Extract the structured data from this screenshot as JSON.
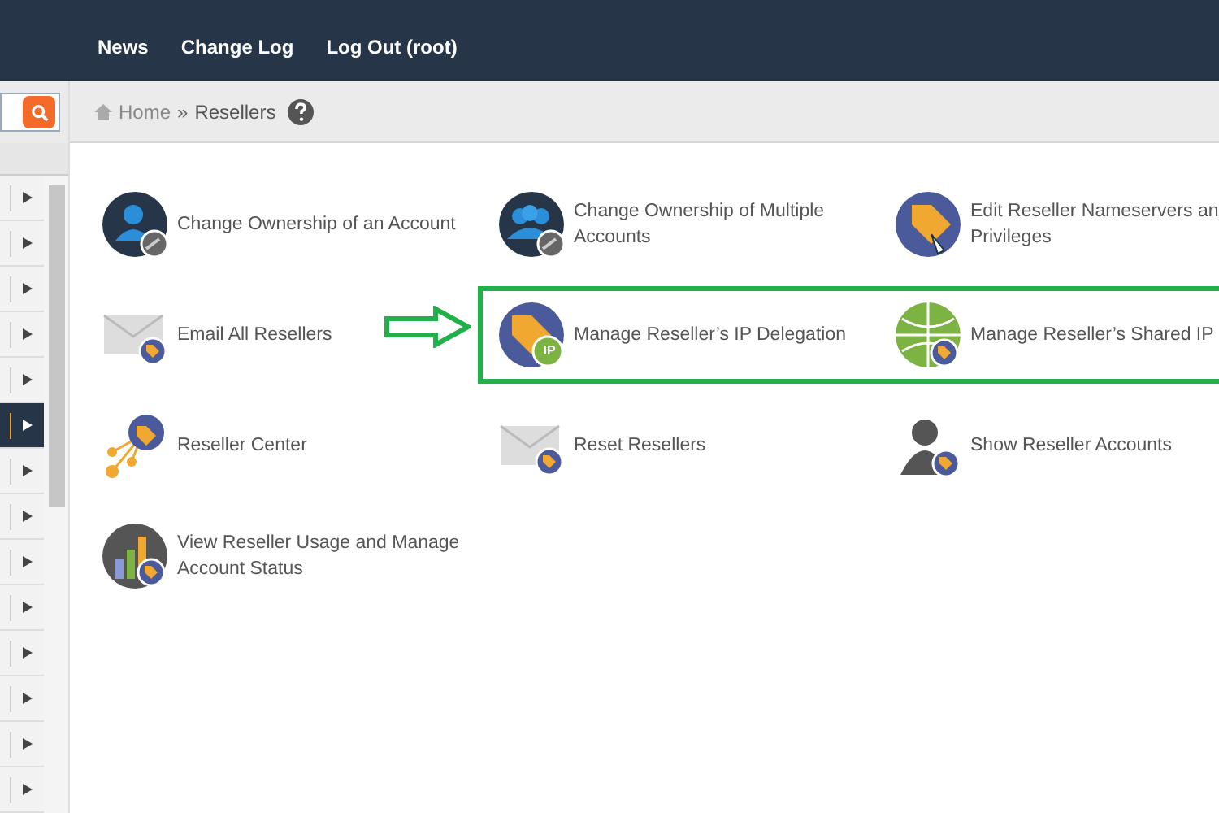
{
  "nav": {
    "items": [
      "News",
      "Change Log",
      "Log Out (root)"
    ]
  },
  "breadcrumb": {
    "home": "Home",
    "separator": "»",
    "current": "Resellers"
  },
  "sidebar": {
    "rows": [
      {
        "selected": false
      },
      {
        "selected": false
      },
      {
        "selected": false
      },
      {
        "selected": false
      },
      {
        "selected": false
      },
      {
        "selected": true
      },
      {
        "selected": false
      },
      {
        "selected": false
      },
      {
        "selected": false
      },
      {
        "selected": false
      },
      {
        "selected": false
      },
      {
        "selected": false
      },
      {
        "selected": false
      },
      {
        "selected": false
      }
    ]
  },
  "features": [
    {
      "label": "Change Ownership of an Account",
      "highlighted": false
    },
    {
      "label": "Change Ownership of Multiple Accounts",
      "highlighted": false
    },
    {
      "label": "Edit Reseller Nameservers an Privileges",
      "highlighted": false
    },
    {
      "label": "Email All Resellers",
      "highlighted": false
    },
    {
      "label": "Manage Reseller’s IP Delegation",
      "highlighted": true,
      "badge": "IP"
    },
    {
      "label": "Manage Reseller’s Shared IP",
      "highlighted": true
    },
    {
      "label": "Reseller Center",
      "highlighted": false
    },
    {
      "label": "Reset Resellers",
      "highlighted": false
    },
    {
      "label": "Show Reseller Accounts",
      "highlighted": false
    },
    {
      "label": "View Reseller Usage and Manage Account Status",
      "highlighted": false
    }
  ]
}
